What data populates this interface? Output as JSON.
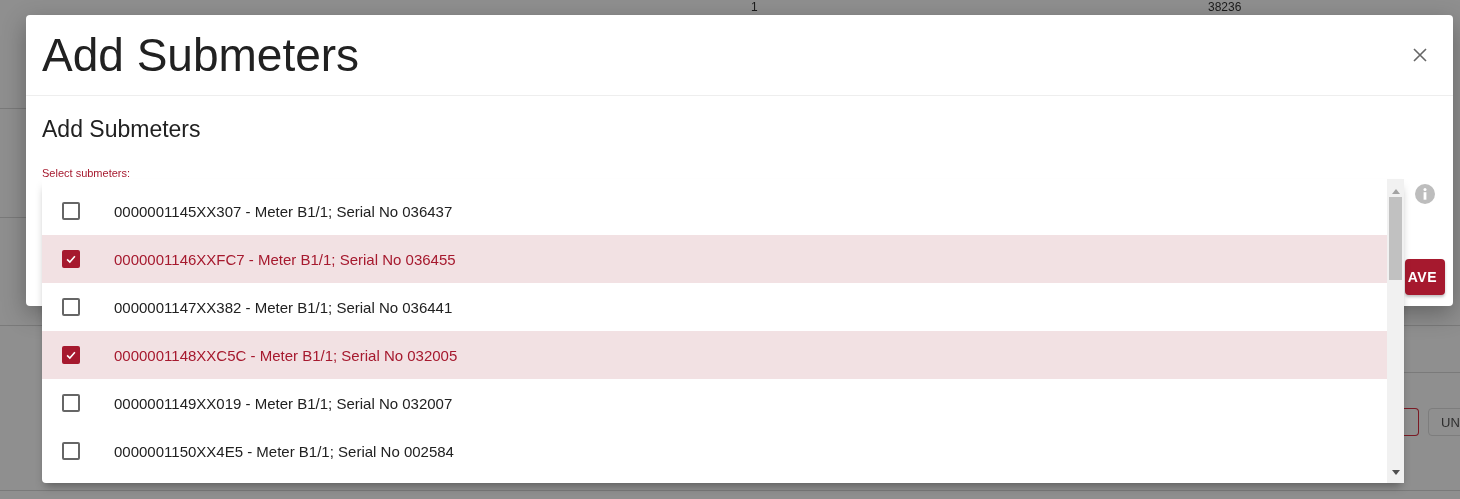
{
  "background": {
    "cells": [
      "1",
      "38236"
    ],
    "button": "UN"
  },
  "dialog": {
    "title": "Add Submeters",
    "subtitle": "Add Submeters",
    "field_label": "Select submeters:",
    "save_button": "AVE"
  },
  "options": [
    {
      "label": "0000001145XX307 - Meter B1/1; Serial No 036437",
      "checked": false
    },
    {
      "label": "0000001146XXFC7 - Meter B1/1; Serial No 036455",
      "checked": true
    },
    {
      "label": "0000001147XX382 - Meter B1/1; Serial No 036441",
      "checked": false
    },
    {
      "label": "0000001148XXC5C - Meter B1/1; Serial No 032005",
      "checked": true
    },
    {
      "label": "0000001149XX019 - Meter B1/1; Serial No 032007",
      "checked": false
    },
    {
      "label": "0000001150XX4E5 - Meter B1/1; Serial No 002584",
      "checked": false
    }
  ]
}
